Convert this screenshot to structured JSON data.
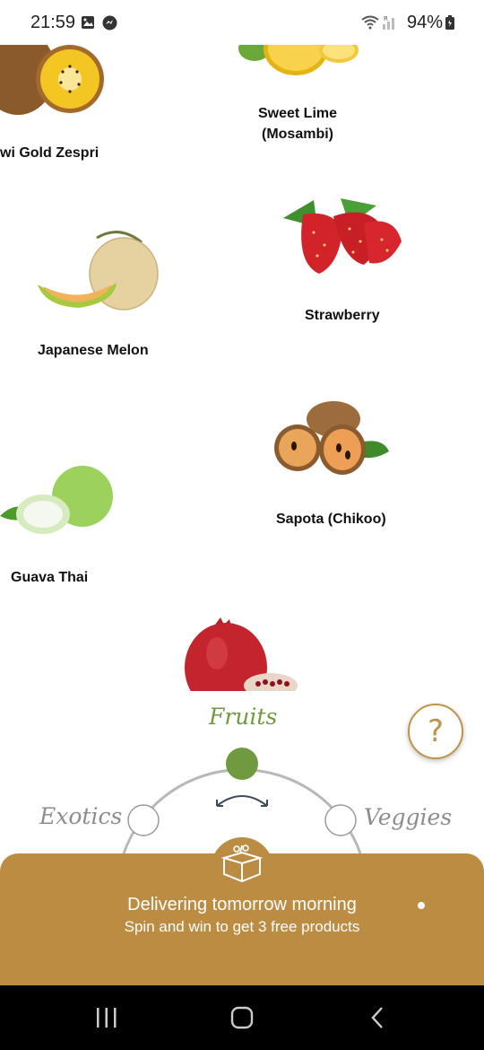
{
  "status_bar": {
    "time": "21:59",
    "battery": "94%",
    "icons": [
      "gallery-icon",
      "messenger-icon",
      "wifi-icon",
      "signal-icon",
      "battery-icon"
    ]
  },
  "products": [
    {
      "name": "wi Gold Zespri",
      "image": "kiwi-gold"
    },
    {
      "name": "Sweet Lime (Mosambi)",
      "image": "sweet-lime"
    },
    {
      "name": "Japanese Melon",
      "image": "japanese-melon"
    },
    {
      "name": "Strawberry",
      "image": "strawberry"
    },
    {
      "name": "Guava Thai",
      "image": "guava"
    },
    {
      "name": "Sapota (Chikoo)",
      "image": "sapota"
    },
    {
      "name": "",
      "image": "pomegranate"
    }
  ],
  "dial": {
    "active": "Fruits",
    "left": "Exotics",
    "right": "Veggies",
    "icon": "rotate-arrow-icon"
  },
  "help": {
    "label": "?"
  },
  "delivery": {
    "title": "Delivering tomorrow morning",
    "subtitle": "Spin and win to get 3 free products",
    "icon": "box-icon"
  },
  "colors": {
    "accent_green": "#6f9a3f",
    "panel_brown": "#bd8c43",
    "dial_gray": "#b8b8b8"
  },
  "nav_bar": {
    "icons": [
      "recents-icon",
      "home-icon",
      "back-icon"
    ]
  }
}
